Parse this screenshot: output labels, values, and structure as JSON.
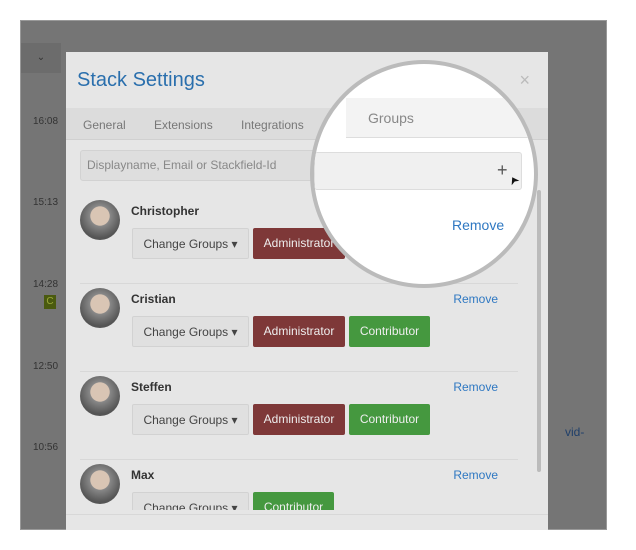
{
  "background": {
    "times": [
      "16:08",
      "15:13",
      "14:28",
      "12:50",
      "10:56"
    ],
    "badge": "C",
    "link_fragment": "vid-"
  },
  "modal": {
    "title": "Stack Settings",
    "close": "×",
    "tabs": [
      "General",
      "Extensions",
      "Integrations",
      "Groups"
    ],
    "active_tab": "Groups",
    "search": {
      "placeholder": "Displayname, Email or Stackfield-Id",
      "add_icon": "+"
    },
    "members": [
      {
        "name": "Christopher",
        "change": "Change Groups ▾",
        "groups": [
          "Administrator"
        ],
        "remove": "Remove"
      },
      {
        "name": "Cristian",
        "change": "Change Groups ▾",
        "groups": [
          "Administrator",
          "Contributor"
        ],
        "remove": "Remove"
      },
      {
        "name": "Steffen",
        "change": "Change Groups ▾",
        "groups": [
          "Administrator",
          "Contributor"
        ],
        "remove": "Remove"
      },
      {
        "name": "Max",
        "change": "Change Groups ▾",
        "groups": [
          "Contributor"
        ],
        "remove": "Remove"
      }
    ]
  },
  "colors": {
    "title": "#2a6fad",
    "administrator": "#7e3838",
    "contributor": "#45983f",
    "link": "#2f78c2"
  }
}
